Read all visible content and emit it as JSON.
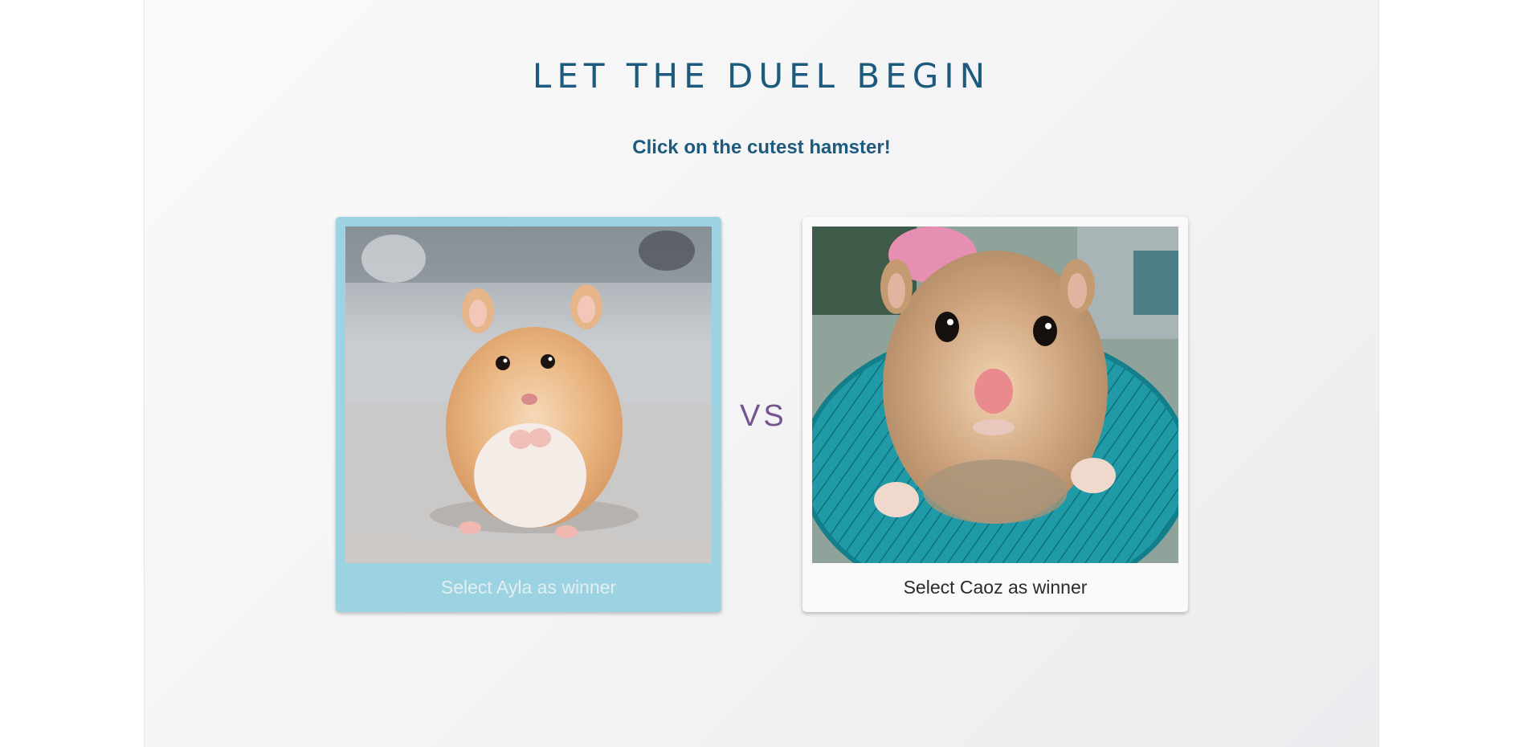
{
  "header": {
    "title": "LET THE DUEL BEGIN",
    "subtitle": "Click on the cutest hamster!"
  },
  "duel": {
    "left": {
      "caption": "Select Ayla as winner",
      "image": "hamster-photo",
      "state": "selected"
    },
    "separator": "VS",
    "right": {
      "caption": "Select Caoz as winner",
      "image": "hamster-photo"
    }
  },
  "colors": {
    "title": "#1d5b7e",
    "selected_card": "#9bd3e2",
    "vs": "#74558f"
  }
}
